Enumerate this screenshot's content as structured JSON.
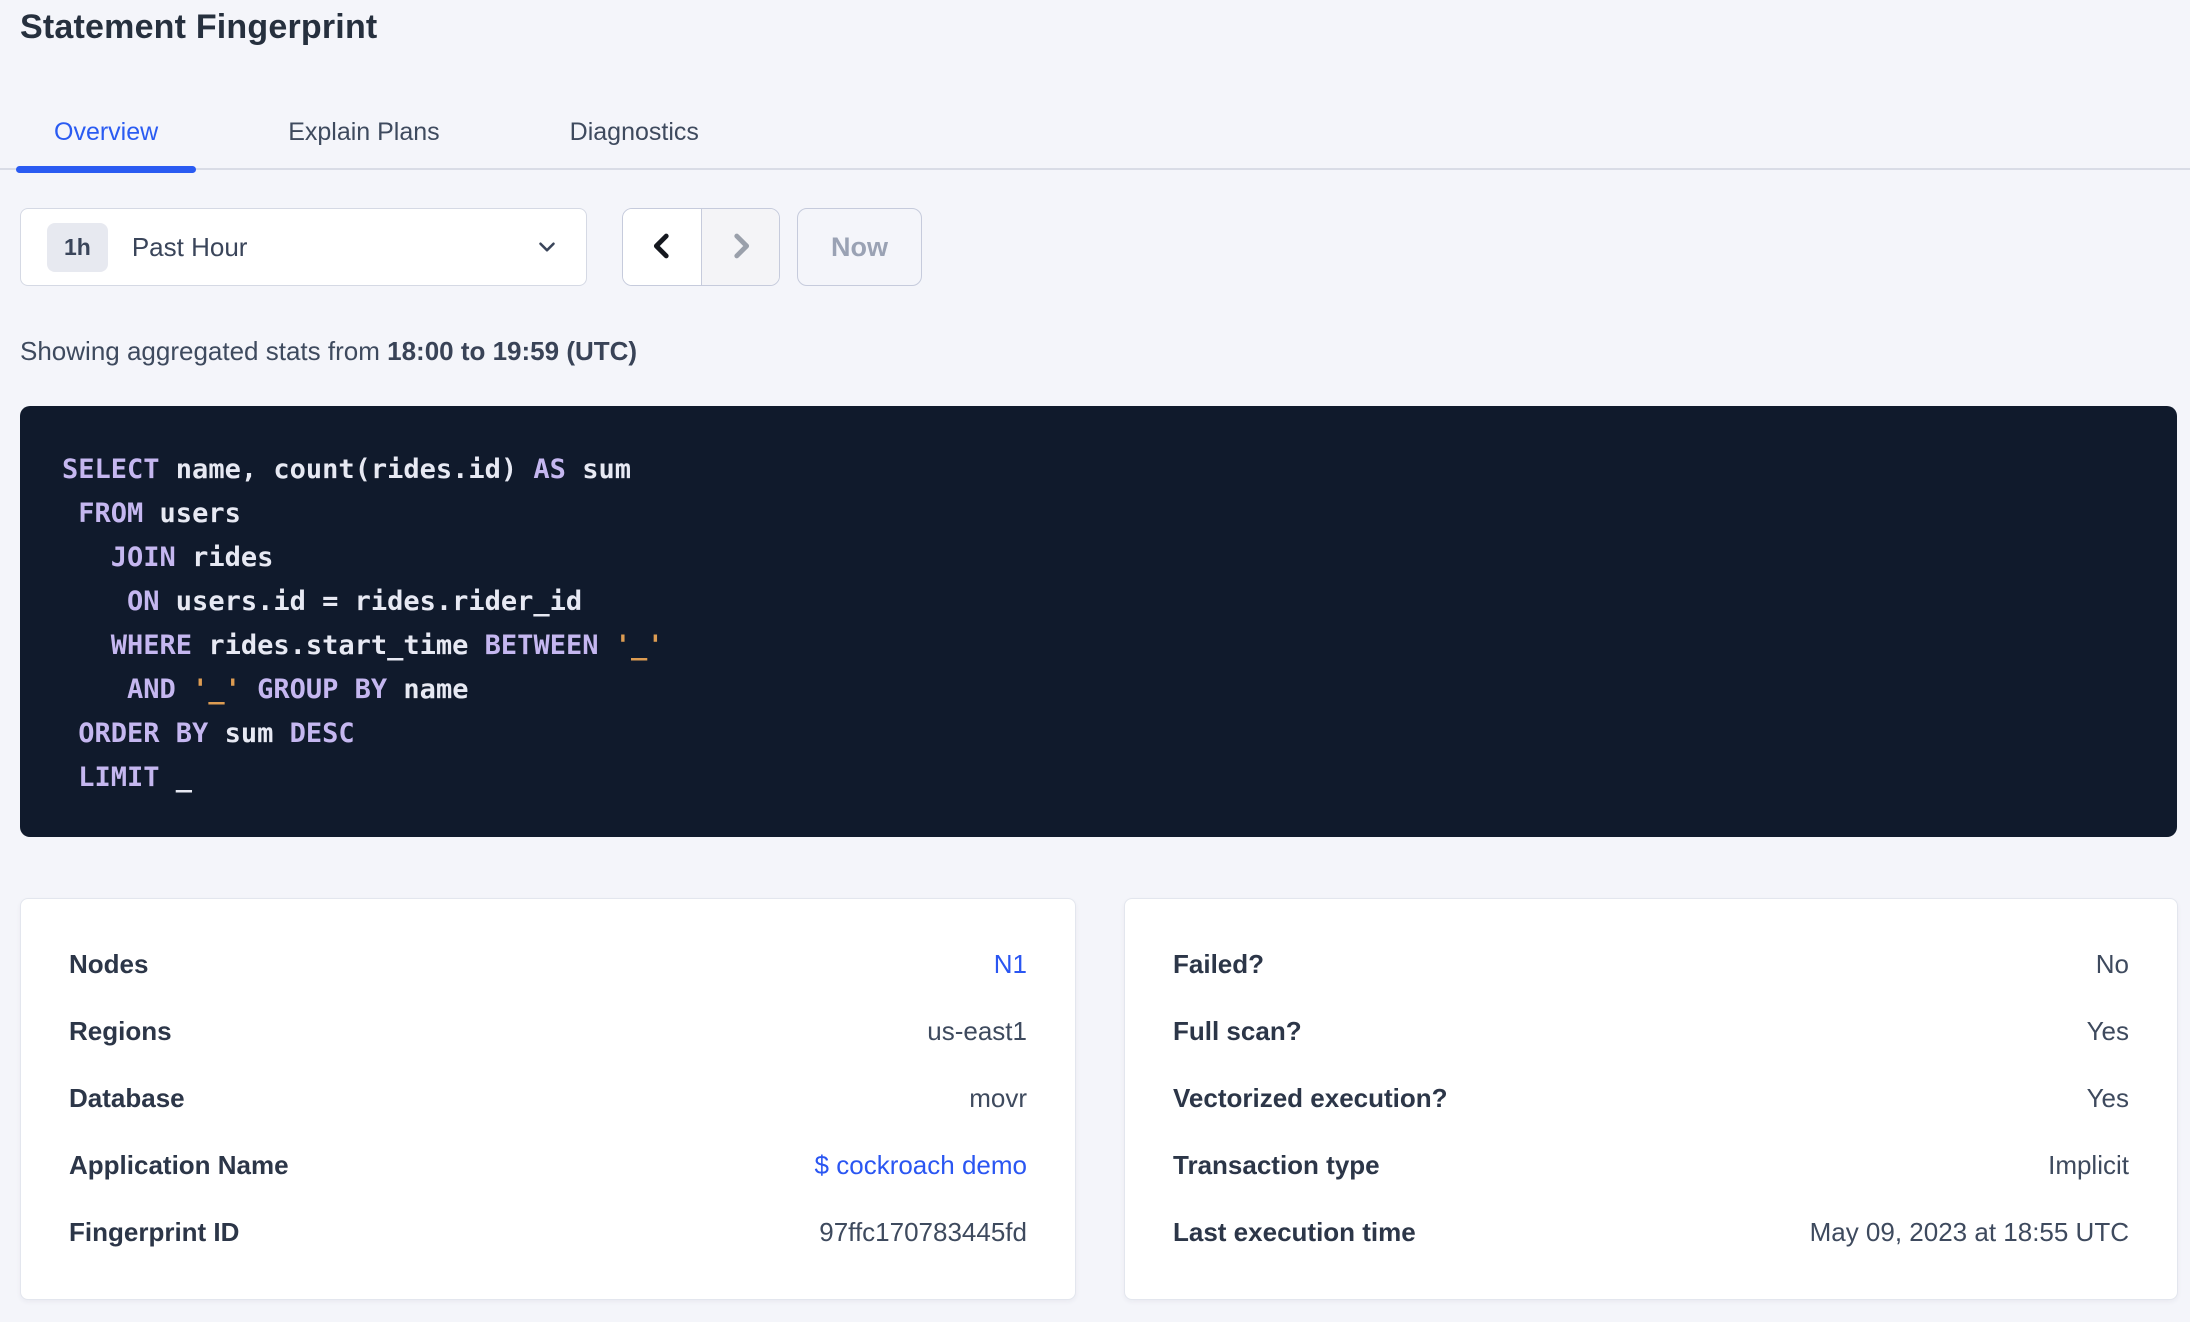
{
  "page": {
    "title": "Statement Fingerprint"
  },
  "tabs": [
    {
      "label": "Overview",
      "active": true
    },
    {
      "label": "Explain Plans",
      "active": false
    },
    {
      "label": "Diagnostics",
      "active": false
    }
  ],
  "time_controls": {
    "interval_badge": "1h",
    "selected_range": "Past Hour",
    "caret_icon": "chevron-down-icon",
    "prev_icon": "chevron-left-icon",
    "next_icon": "chevron-right-icon",
    "now_label": "Now"
  },
  "stats": {
    "prefix": "Showing aggregated stats from ",
    "range_bold": "18:00 to 19:59 (UTC)"
  },
  "sql": {
    "lines": [
      [
        {
          "t": "kw",
          "v": "SELECT"
        },
        {
          "t": "pl",
          "v": " name, count(rides.id) "
        },
        {
          "t": "kw",
          "v": "AS"
        },
        {
          "t": "pl",
          "v": " sum"
        }
      ],
      [
        {
          "t": "pl",
          "v": " "
        },
        {
          "t": "kw",
          "v": "FROM"
        },
        {
          "t": "pl",
          "v": " users"
        }
      ],
      [
        {
          "t": "pl",
          "v": "   "
        },
        {
          "t": "kw",
          "v": "JOIN"
        },
        {
          "t": "pl",
          "v": " rides"
        }
      ],
      [
        {
          "t": "pl",
          "v": "    "
        },
        {
          "t": "kw",
          "v": "ON"
        },
        {
          "t": "pl",
          "v": " users.id = rides.rider_id"
        }
      ],
      [
        {
          "t": "pl",
          "v": "   "
        },
        {
          "t": "kw",
          "v": "WHERE"
        },
        {
          "t": "pl",
          "v": " rides.start_time "
        },
        {
          "t": "kw",
          "v": "BETWEEN"
        },
        {
          "t": "pl",
          "v": " "
        },
        {
          "t": "str",
          "v": "'_'"
        }
      ],
      [
        {
          "t": "pl",
          "v": "    "
        },
        {
          "t": "kw",
          "v": "AND"
        },
        {
          "t": "pl",
          "v": " "
        },
        {
          "t": "str",
          "v": "'_'"
        },
        {
          "t": "pl",
          "v": " "
        },
        {
          "t": "kw",
          "v": "GROUP BY"
        },
        {
          "t": "pl",
          "v": " name"
        }
      ],
      [
        {
          "t": "pl",
          "v": " "
        },
        {
          "t": "kw",
          "v": "ORDER BY"
        },
        {
          "t": "pl",
          "v": " sum "
        },
        {
          "t": "kw",
          "v": "DESC"
        }
      ],
      [
        {
          "t": "pl",
          "v": " "
        },
        {
          "t": "kw",
          "v": "LIMIT"
        },
        {
          "t": "pl",
          "v": " _"
        }
      ]
    ]
  },
  "cards": {
    "left": {
      "rows": [
        {
          "label": "Nodes",
          "value": "N1",
          "link": true
        },
        {
          "label": "Regions",
          "value": "us-east1",
          "link": false
        },
        {
          "label": "Database",
          "value": "movr",
          "link": false
        },
        {
          "label": "Application Name",
          "value": "$ cockroach demo",
          "link": true
        },
        {
          "label": "Fingerprint ID",
          "value": "97ffc170783445fd",
          "link": false
        }
      ]
    },
    "right": {
      "rows": [
        {
          "label": "Failed?",
          "value": "No",
          "link": false
        },
        {
          "label": "Full scan?",
          "value": "Yes",
          "link": false
        },
        {
          "label": "Vectorized execution?",
          "value": "Yes",
          "link": false
        },
        {
          "label": "Transaction type",
          "value": "Implicit",
          "link": false
        },
        {
          "label": "Last execution time",
          "value": "May 09, 2023 at 18:55 UTC",
          "link": false
        }
      ]
    }
  },
  "colors": {
    "accent_blue": "#2a5bf2",
    "link_blue": "#2a56f2",
    "code_background": "#101a2c",
    "code_keyword": "#c5b7f0",
    "code_text": "#e7e9f3",
    "code_string": "#dd9c52",
    "page_background": "#f4f5fa"
  }
}
